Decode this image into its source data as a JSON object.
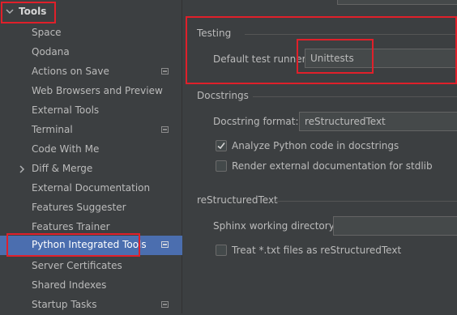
{
  "sidebar": {
    "tools_label": "Tools",
    "items": [
      {
        "label": "Space"
      },
      {
        "label": "Qodana"
      },
      {
        "label": "Actions on Save"
      },
      {
        "label": "Web Browsers and Preview"
      },
      {
        "label": "External Tools"
      },
      {
        "label": "Terminal"
      },
      {
        "label": "Code With Me"
      },
      {
        "label": "Diff & Merge"
      },
      {
        "label": "External Documentation"
      },
      {
        "label": "Features Suggester"
      },
      {
        "label": "Features Trainer"
      },
      {
        "label": "Python Integrated Tools"
      },
      {
        "label": "Server Certificates"
      },
      {
        "label": "Shared Indexes"
      },
      {
        "label": "Startup Tasks"
      }
    ],
    "selected": "Python Integrated Tools"
  },
  "testing": {
    "title": "Testing",
    "runner_label": "Default test runner:",
    "runner_value": "Unittests"
  },
  "docstrings": {
    "title": "Docstrings",
    "format_label": "Docstring format:",
    "format_value": "reStructuredText",
    "analyze_label": "Analyze Python code in docstrings",
    "analyze_checked": true,
    "render_label": "Render external documentation for stdlib",
    "render_checked": false
  },
  "rst": {
    "title": "reStructuredText",
    "sphinx_label": "Sphinx working directory:",
    "sphinx_value": "",
    "treat_txt_label": "Treat *.txt files as reStructuredText",
    "treat_txt_checked": false
  },
  "colors": {
    "selection": "#4b6eaf",
    "highlight": "#e0202a"
  }
}
